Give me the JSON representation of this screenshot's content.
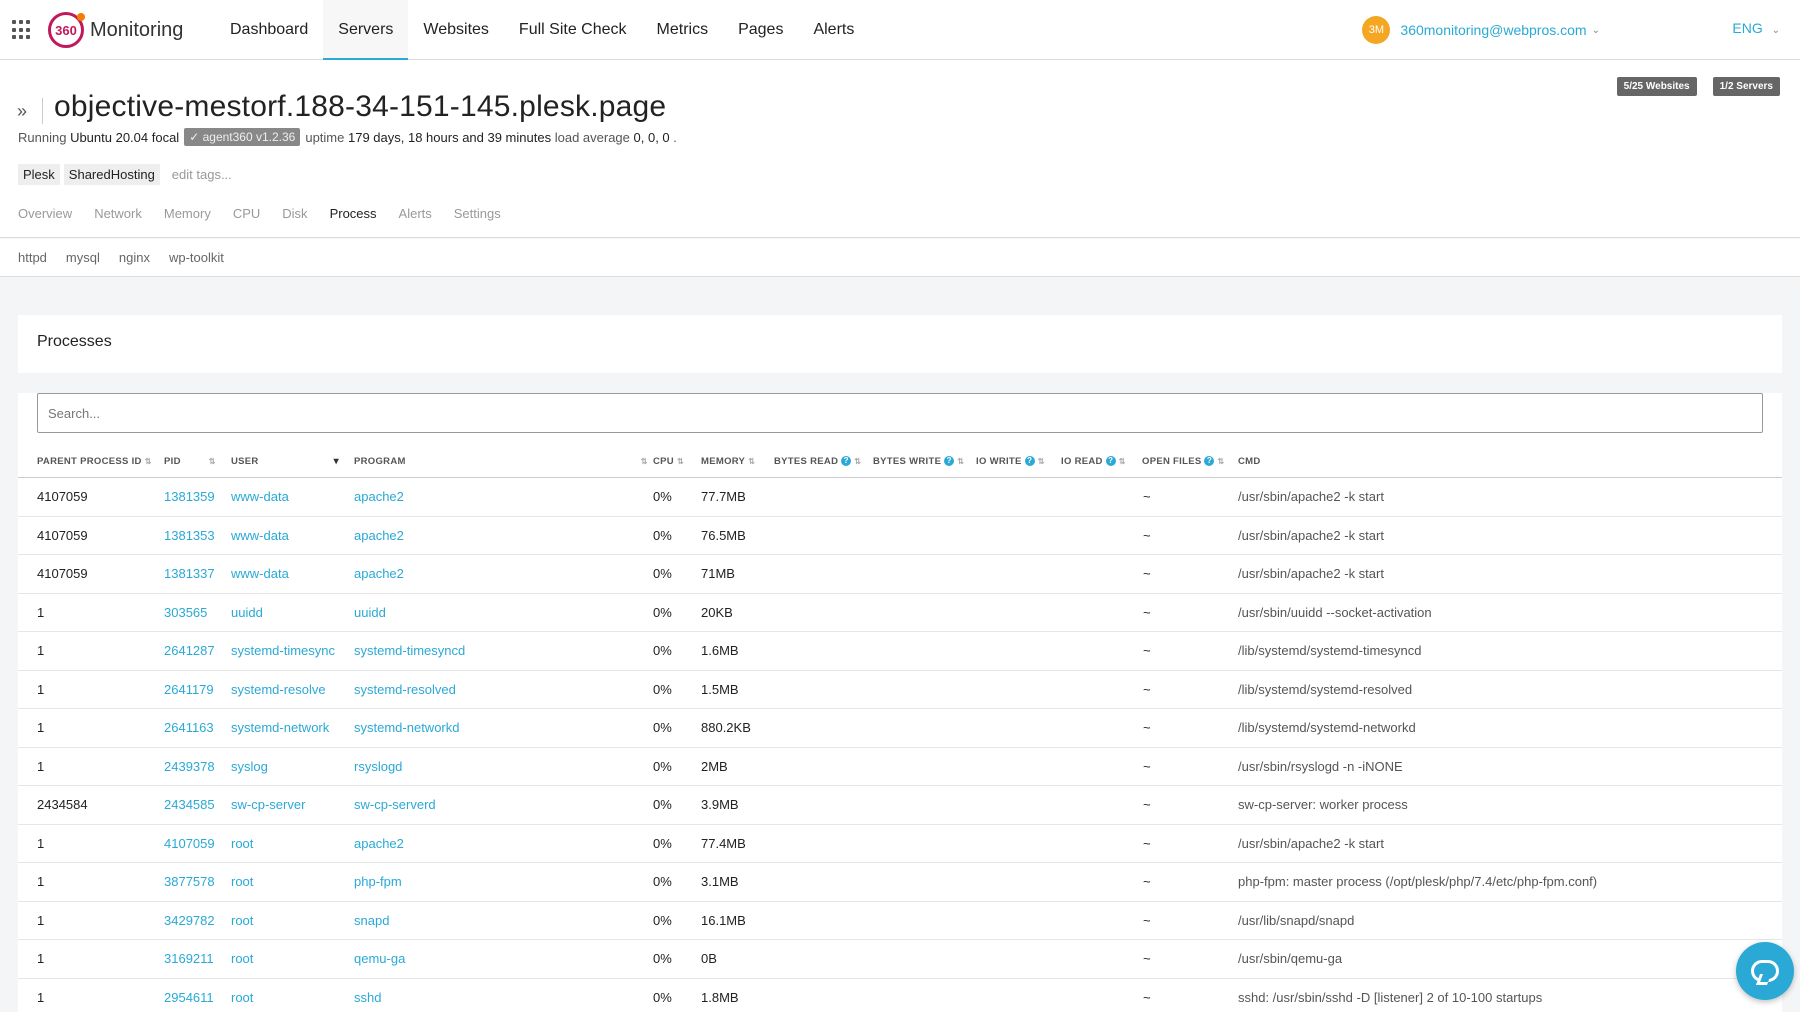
{
  "app": {
    "logo_mark": "360",
    "logo_text": "Monitoring"
  },
  "nav": {
    "items": [
      {
        "label": "Dashboard"
      },
      {
        "label": "Servers"
      },
      {
        "label": "Websites"
      },
      {
        "label": "Full Site Check"
      },
      {
        "label": "Metrics"
      },
      {
        "label": "Pages"
      },
      {
        "label": "Alerts"
      }
    ],
    "active": "Servers"
  },
  "user": {
    "initials": "3M",
    "email": "360monitoring@webpros.com",
    "language": "ENG"
  },
  "quota": {
    "websites": "5/25 Websites",
    "servers": "1/2 Servers"
  },
  "server": {
    "name": "objective-mestorf.188-34-151-145.plesk.page",
    "running_label": "Running",
    "os": "Ubuntu 20.04 focal",
    "agent": "agent360 v1.2.36",
    "uptime_label": "uptime",
    "uptime": "179 days, 18 hours and 39 minutes",
    "load_label": "load average",
    "load": "0, 0, 0",
    "load_suffix": ".",
    "tags": [
      "Plesk",
      "SharedHosting"
    ],
    "edit_tags": "edit tags..."
  },
  "subtabs": [
    "Overview",
    "Network",
    "Memory",
    "CPU",
    "Disk",
    "Process",
    "Alerts",
    "Settings"
  ],
  "active_subtab": "Process",
  "process_filters": [
    "httpd",
    "mysql",
    "nginx",
    "wp-toolkit"
  ],
  "processes": {
    "title": "Processes",
    "search_placeholder": "Search...",
    "columns": [
      "PARENT PROCESS ID",
      "PID",
      "USER",
      "PROGRAM",
      "CPU",
      "MEMORY",
      "BYTES READ",
      "BYTES WRITE",
      "IO WRITE",
      "IO READ",
      "OPEN FILES",
      "CMD"
    ],
    "rows": [
      {
        "ppid": "4107059",
        "pid": "1381359",
        "user": "www-data",
        "program": "apache2",
        "cpu": "0%",
        "memory": "77.7MB",
        "open_files": "~",
        "cmd": "/usr/sbin/apache2 -k start"
      },
      {
        "ppid": "4107059",
        "pid": "1381353",
        "user": "www-data",
        "program": "apache2",
        "cpu": "0%",
        "memory": "76.5MB",
        "open_files": "~",
        "cmd": "/usr/sbin/apache2 -k start"
      },
      {
        "ppid": "4107059",
        "pid": "1381337",
        "user": "www-data",
        "program": "apache2",
        "cpu": "0%",
        "memory": "71MB",
        "open_files": "~",
        "cmd": "/usr/sbin/apache2 -k start"
      },
      {
        "ppid": "1",
        "pid": "303565",
        "user": "uuidd",
        "program": "uuidd",
        "cpu": "0%",
        "memory": "20KB",
        "open_files": "~",
        "cmd": "/usr/sbin/uuidd --socket-activation"
      },
      {
        "ppid": "1",
        "pid": "2641287",
        "user": "systemd-timesync",
        "program": "systemd-timesyncd",
        "cpu": "0%",
        "memory": "1.6MB",
        "open_files": "~",
        "cmd": "/lib/systemd/systemd-timesyncd"
      },
      {
        "ppid": "1",
        "pid": "2641179",
        "user": "systemd-resolve",
        "program": "systemd-resolved",
        "cpu": "0%",
        "memory": "1.5MB",
        "open_files": "~",
        "cmd": "/lib/systemd/systemd-resolved"
      },
      {
        "ppid": "1",
        "pid": "2641163",
        "user": "systemd-network",
        "program": "systemd-networkd",
        "cpu": "0%",
        "memory": "880.2KB",
        "open_files": "~",
        "cmd": "/lib/systemd/systemd-networkd"
      },
      {
        "ppid": "1",
        "pid": "2439378",
        "user": "syslog",
        "program": "rsyslogd",
        "cpu": "0%",
        "memory": "2MB",
        "open_files": "~",
        "cmd": "/usr/sbin/rsyslogd -n -iNONE"
      },
      {
        "ppid": "2434584",
        "pid": "2434585",
        "user": "sw-cp-server",
        "program": "sw-cp-serverd",
        "cpu": "0%",
        "memory": "3.9MB",
        "open_files": "~",
        "cmd": "sw-cp-server: worker process"
      },
      {
        "ppid": "1",
        "pid": "4107059",
        "user": "root",
        "program": "apache2",
        "cpu": "0%",
        "memory": "77.4MB",
        "open_files": "~",
        "cmd": "/usr/sbin/apache2 -k start"
      },
      {
        "ppid": "1",
        "pid": "3877578",
        "user": "root",
        "program": "php-fpm",
        "cpu": "0%",
        "memory": "3.1MB",
        "open_files": "~",
        "cmd": "php-fpm: master process (/opt/plesk/php/7.4/etc/php-fpm.conf)"
      },
      {
        "ppid": "1",
        "pid": "3429782",
        "user": "root",
        "program": "snapd",
        "cpu": "0%",
        "memory": "16.1MB",
        "open_files": "~",
        "cmd": "/usr/lib/snapd/snapd"
      },
      {
        "ppid": "1",
        "pid": "3169211",
        "user": "root",
        "program": "qemu-ga",
        "cpu": "0%",
        "memory": "0B",
        "open_files": "~",
        "cmd": "/usr/sbin/qemu-ga"
      },
      {
        "ppid": "1",
        "pid": "2954611",
        "user": "root",
        "program": "sshd",
        "cpu": "0%",
        "memory": "1.8MB",
        "open_files": "~",
        "cmd": "sshd: /usr/sbin/sshd -D [listener] 2 of 10-100 startups"
      }
    ]
  },
  "colors": {
    "accent": "#2aa9d6",
    "brand": "#c2185b",
    "avatar": "#f5a623"
  }
}
